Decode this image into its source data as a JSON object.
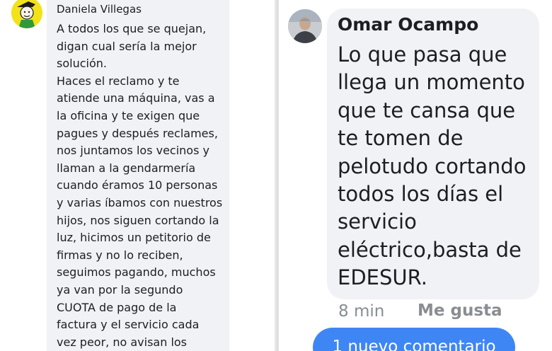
{
  "left_comment": {
    "author": "Daniela Villegas",
    "body_lines": [
      "A todos los que se quejan,",
      "digan cual sería la mejor",
      "solución.",
      "Haces el reclamo y te",
      "atiende una máquina, vas a",
      "la oficina y te exigen que",
      "pagues y después reclames,",
      "nos juntamos los vecinos y",
      "llaman a la gendarmería",
      "cuando éramos 10 personas",
      "y varias íbamos con nuestros",
      "hijos, nos siguen cortando la",
      "luz, hicimos un petitorio de",
      "firmas y no lo reciben,",
      "seguimos pagando, muchos",
      "ya van por la segundo",
      "CUOTA de pago de la",
      "factura y el servicio cada",
      "vez peor, no avisan los"
    ]
  },
  "right_comment": {
    "author": "Omar Ocampo",
    "body_lines": [
      "Lo que pasa que",
      "llega un momento",
      "que te cansa que",
      "te tomen de",
      "pelotudo cortando",
      "todos los días el",
      "servicio",
      "eléctrico,basta de",
      "EDESUR."
    ],
    "time": "8 min",
    "like_label": "Me gusta"
  },
  "new_comments_button": "1 nuevo comentario",
  "colors": {
    "bubble": "#f0f2f5",
    "text": "#1c1e21",
    "meta": "#8a8d91",
    "accent": "#3f86f5",
    "avatar_left": "#f2e21a"
  }
}
